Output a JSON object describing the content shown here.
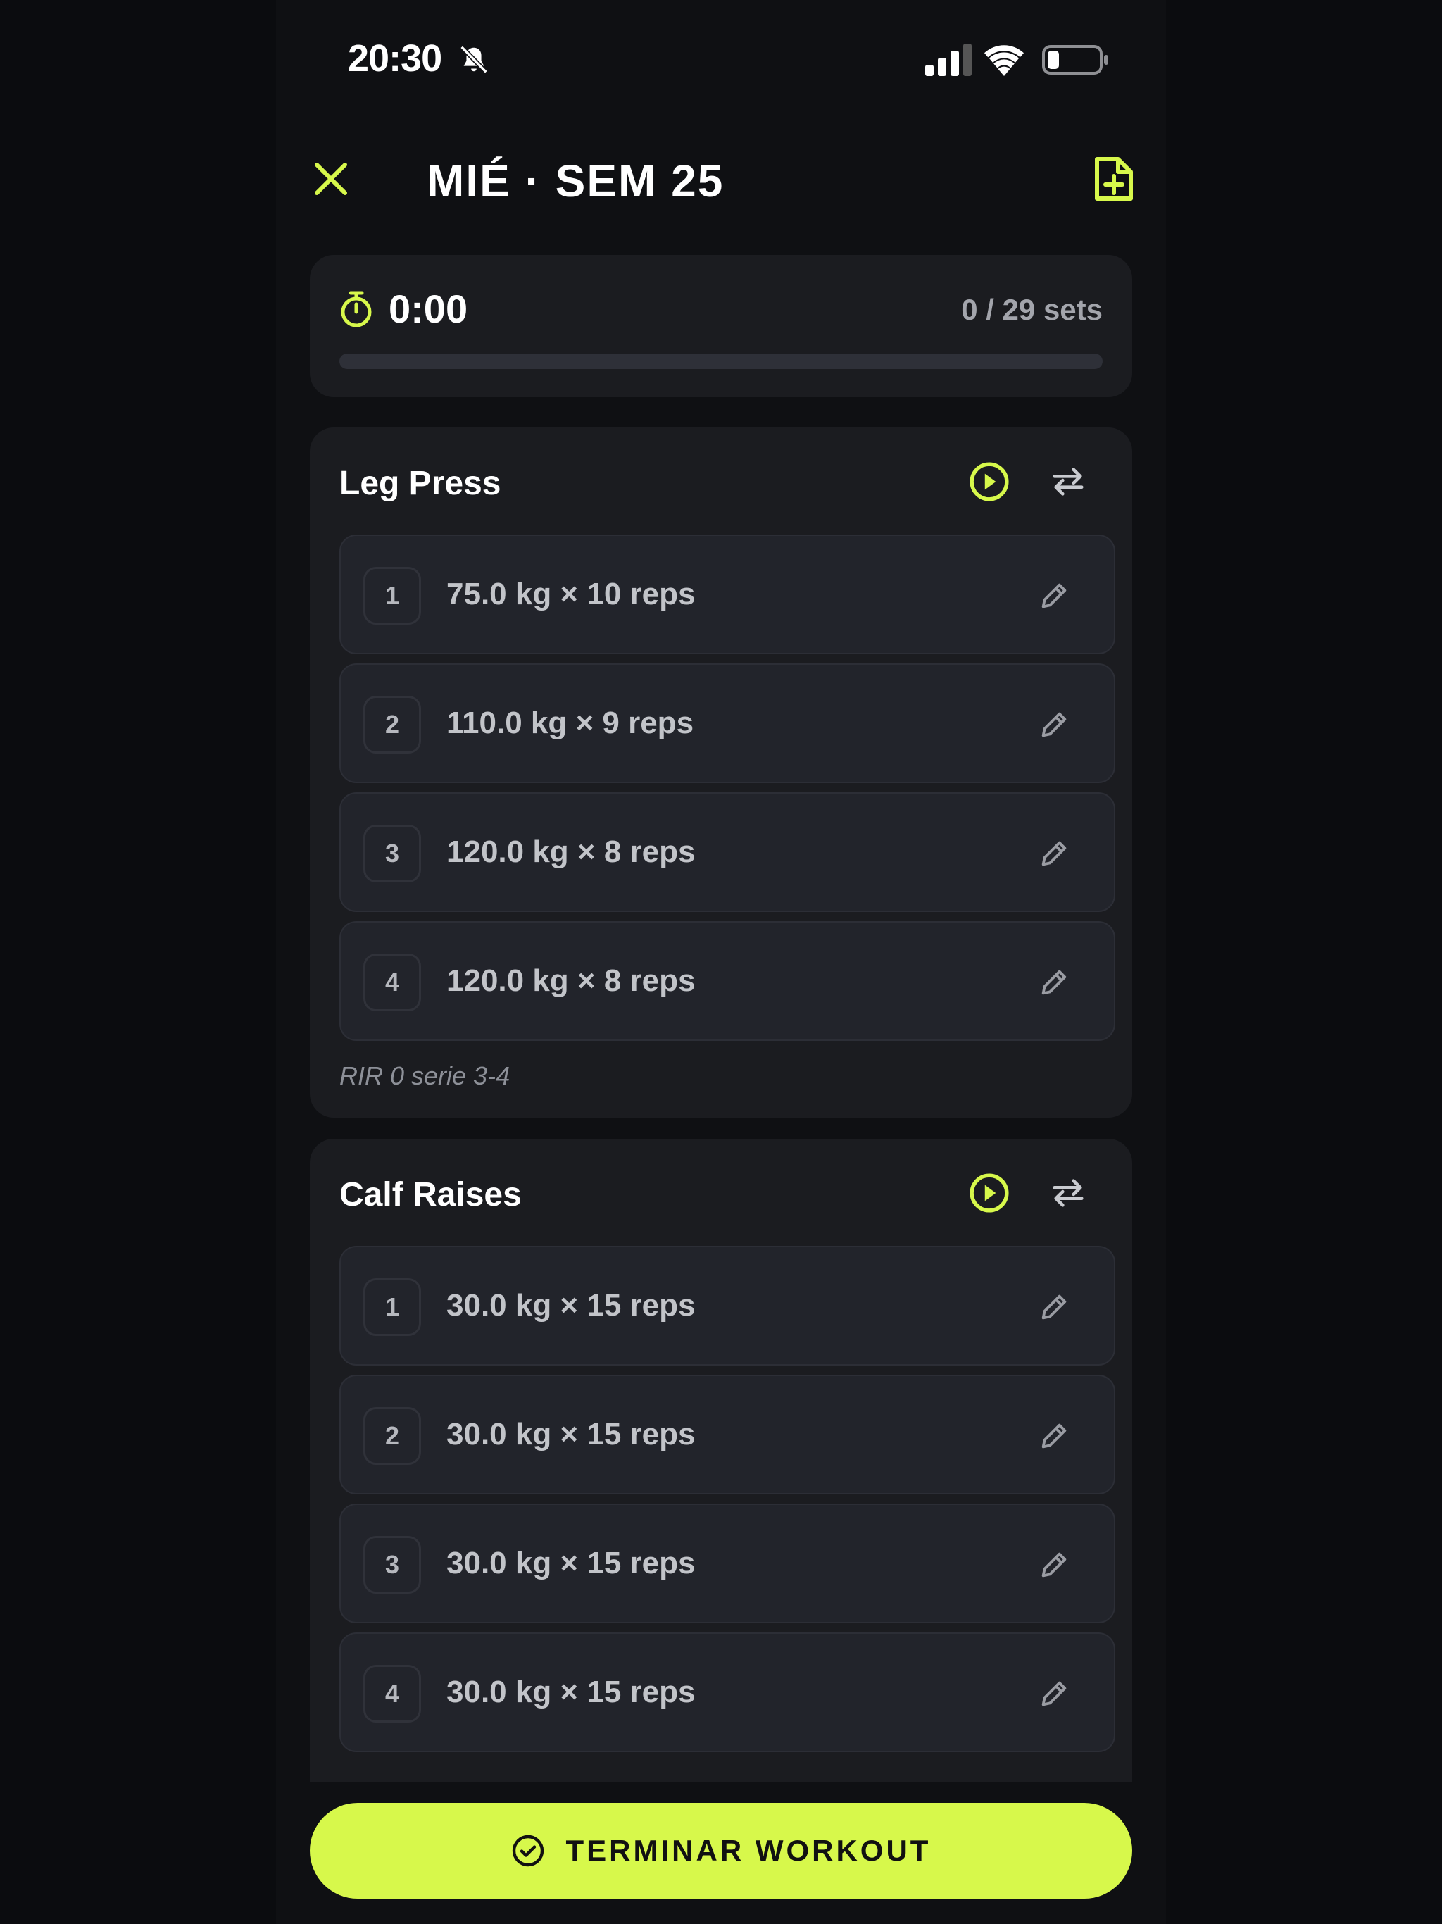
{
  "status_bar": {
    "time": "20:30"
  },
  "header": {
    "title": "MIÉ · SEM 25"
  },
  "timer": {
    "elapsed": "0:00",
    "sets_progress": "0 / 29 sets",
    "progress_fraction": 0
  },
  "exercises": [
    {
      "name": "Leg Press",
      "sets": [
        {
          "num": "1",
          "text": "75.0 kg × 10 reps"
        },
        {
          "num": "2",
          "text": "110.0 kg × 9 reps"
        },
        {
          "num": "3",
          "text": "120.0 kg × 8 reps"
        },
        {
          "num": "4",
          "text": "120.0 kg × 8 reps"
        }
      ],
      "note": "RIR 0 serie 3-4"
    },
    {
      "name": "Calf Raises",
      "sets": [
        {
          "num": "1",
          "text": "30.0 kg × 15 reps"
        },
        {
          "num": "2",
          "text": "30.0 kg × 15 reps"
        },
        {
          "num": "3",
          "text": "30.0 kg × 15 reps"
        },
        {
          "num": "4",
          "text": "30.0 kg × 15 reps"
        }
      ]
    }
  ],
  "footer": {
    "finish_label": "TERMINAR WORKOUT"
  },
  "colors": {
    "accent": "#d7f84b",
    "background": "#0f1013",
    "card": "#1b1c20",
    "row": "#22242b"
  }
}
